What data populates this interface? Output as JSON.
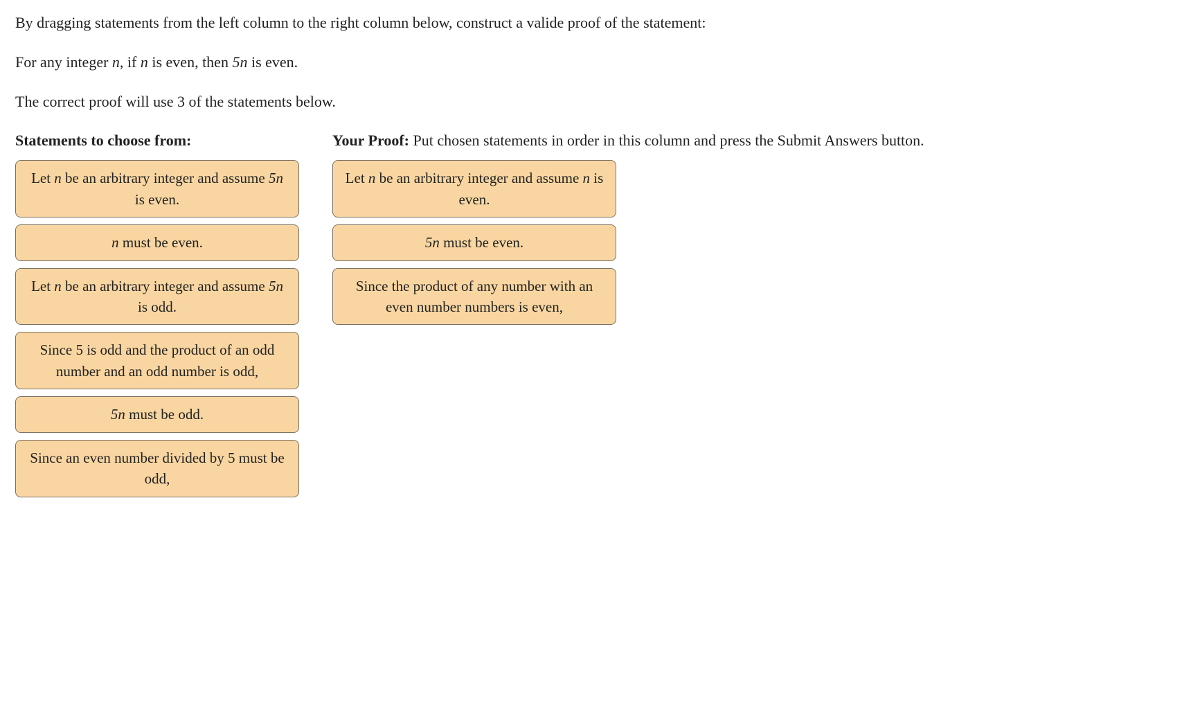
{
  "instructions": {
    "line1_a": "By dragging statements from the left column to the right column below, construct a valide proof of the statement:",
    "line2_a": "For any integer ",
    "line2_n": "n",
    "line2_b": ", if ",
    "line2_n2": "n",
    "line2_c": " is even, then ",
    "line2_5n": "5n",
    "line2_d": " is even.",
    "line3": "The correct proof will use 3 of the statements below."
  },
  "left": {
    "header": "Statements to choose from:",
    "cards": [
      {
        "pre": "Let ",
        "v1": "n",
        "mid1": " be an arbitrary integer and assume ",
        "v2": "5n",
        "mid2": " is even.",
        "post": ""
      },
      {
        "pre": "",
        "v1": "n",
        "mid1": " must be even.",
        "v2": "",
        "mid2": "",
        "post": ""
      },
      {
        "pre": "Let ",
        "v1": "n",
        "mid1": " be an arbitrary integer and assume ",
        "v2": "5n",
        "mid2": " is odd.",
        "post": ""
      },
      {
        "pre": "Since 5 is odd and the product of an odd number and an odd number is odd,",
        "v1": "",
        "mid1": "",
        "v2": "",
        "mid2": "",
        "post": ""
      },
      {
        "pre": "",
        "v1": "5n",
        "mid1": " must be odd.",
        "v2": "",
        "mid2": "",
        "post": ""
      },
      {
        "pre": "Since an even number divided by 5 must be odd,",
        "v1": "",
        "mid1": "",
        "v2": "",
        "mid2": "",
        "post": ""
      }
    ]
  },
  "right": {
    "header_strong": "Your Proof:",
    "header_rest": " Put chosen statements in order in this column and press the Submit Answers button.",
    "cards": [
      {
        "pre": "Let ",
        "v1": "n",
        "mid1": " be an arbitrary integer and assume ",
        "v2": "n",
        "mid2": " is even.",
        "post": ""
      },
      {
        "pre": "",
        "v1": "5n",
        "mid1": " must be even.",
        "v2": "",
        "mid2": "",
        "post": ""
      },
      {
        "pre": "Since the product of any number with an even number numbers is even,",
        "v1": "",
        "mid1": "",
        "v2": "",
        "mid2": "",
        "post": ""
      }
    ]
  }
}
